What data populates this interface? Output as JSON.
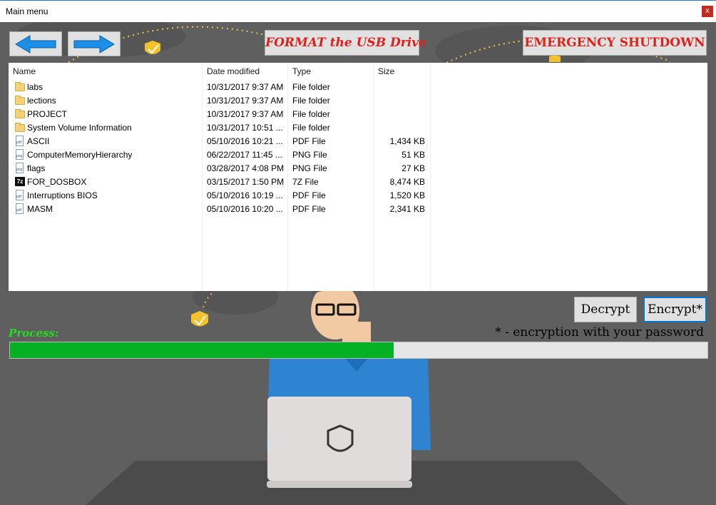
{
  "window": {
    "title": "Main menu",
    "close_label": "x"
  },
  "toolbar": {
    "back_icon": "left-arrow-icon",
    "forward_icon": "right-arrow-icon",
    "format_label": "FORMAT the USB Drive",
    "shutdown_label": "EMERGENCY SHUTDOWN"
  },
  "file_list": {
    "columns": {
      "name": "Name",
      "date": "Date modified",
      "type": "Type",
      "size": "Size"
    },
    "rows": [
      {
        "name": "labs",
        "date": "10/31/2017 9:37 AM",
        "type": "File folder",
        "size": "",
        "icon": "folder-icon"
      },
      {
        "name": "lections",
        "date": "10/31/2017 9:37 AM",
        "type": "File folder",
        "size": "",
        "icon": "folder-icon"
      },
      {
        "name": "PROJECT",
        "date": "10/31/2017 9:37 AM",
        "type": "File folder",
        "size": "",
        "icon": "folder-icon"
      },
      {
        "name": "System Volume Information",
        "date": "10/31/2017 10:51 ...",
        "type": "File folder",
        "size": "",
        "icon": "folder-icon"
      },
      {
        "name": "ASCII",
        "date": "05/10/2016 10:21 ...",
        "type": "PDF File",
        "size": "1,434 KB",
        "icon": "pdf-icon"
      },
      {
        "name": "ComputerMemoryHierarchy",
        "date": "06/22/2017 11:45 ...",
        "type": "PNG File",
        "size": "51 KB",
        "icon": "image-icon"
      },
      {
        "name": "flags",
        "date": "03/28/2017 4:08 PM",
        "type": "PNG File",
        "size": "27 KB",
        "icon": "image-icon"
      },
      {
        "name": "FOR_DOSBOX",
        "date": "03/15/2017 1:50 PM",
        "type": "7Z File",
        "size": "8,474 KB",
        "icon": "archive-7z-icon"
      },
      {
        "name": "Interruptions BIOS",
        "date": "05/10/2016 10:19 ...",
        "type": "PDF File",
        "size": "1,520 KB",
        "icon": "pdf-icon"
      },
      {
        "name": "MASM",
        "date": "05/10/2016 10:20 ...",
        "type": "PDF File",
        "size": "2,341 KB",
        "icon": "pdf-icon"
      }
    ]
  },
  "actions": {
    "decrypt_label": "Decrypt",
    "encrypt_label": "Encrypt*"
  },
  "process": {
    "label": "Process:",
    "note": "* - encryption with your password",
    "progress": 0.55
  },
  "colors": {
    "accent_red": "#e0201a",
    "progress_green": "#06b025",
    "process_label_green": "#22dd22",
    "background": "#5f5f5f"
  }
}
